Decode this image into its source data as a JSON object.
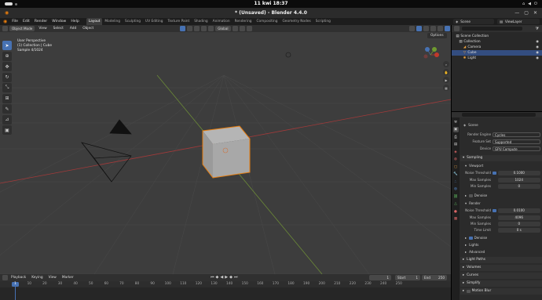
{
  "system": {
    "clock": "11 kwi  18:37"
  },
  "window": {
    "title": "* (Unsaved) - Blender 4.4.0"
  },
  "menu": {
    "items": [
      "File",
      "Edit",
      "Render",
      "Window",
      "Help"
    ]
  },
  "workspaces": [
    "Layout",
    "Modeling",
    "Sculpting",
    "UV Editing",
    "Texture Paint",
    "Shading",
    "Animation",
    "Rendering",
    "Compositing",
    "Geometry Nodes",
    "Scripting"
  ],
  "scene_selector": "Scene",
  "view_layer_selector": "ViewLayer",
  "viewport": {
    "mode": "Object Mode",
    "menus": [
      "View",
      "Select",
      "Add",
      "Object"
    ],
    "transform": "Global",
    "options": "Options",
    "info": [
      "User Perspective",
      "(1) Collection | Cube",
      "Sample 4/1024"
    ]
  },
  "outliner": {
    "rows": [
      {
        "label": "Scene Collection",
        "icon": "collection-icon"
      },
      {
        "label": "Collection",
        "icon": "collection-icon"
      },
      {
        "label": "Camera",
        "icon": "camera-icon"
      },
      {
        "label": "Cube",
        "icon": "mesh-icon"
      },
      {
        "label": "Light",
        "icon": "light-icon"
      }
    ]
  },
  "properties": {
    "scene_label": "Scene",
    "render_engine_label": "Render Engine",
    "render_engine": "Cycles",
    "feature_set_label": "Feature Set",
    "feature_set": "Supported",
    "device_label": "Device",
    "device": "GPU Compute",
    "sampling": "Sampling",
    "viewport": "Viewport",
    "noise_threshold_label": "Noise Threshold",
    "vp_noise": "0.1000",
    "max_samples_label": "Max Samples",
    "vp_max": "1024",
    "min_samples_label": "Min Samples",
    "vp_min": "0",
    "denoise": "Denoise",
    "render": "Render",
    "r_noise": "0.0100",
    "r_max": "4096",
    "r_min": "0",
    "time_limit_label": "Time Limit",
    "r_time": "0 s",
    "lights": "Lights",
    "advanced": "Advanced",
    "sections": [
      "Light Paths",
      "Volumes",
      "Curves",
      "Simplify",
      "Motion Blur"
    ]
  },
  "timeline": {
    "menus": [
      "Playback",
      "Keying",
      "View",
      "Marker"
    ],
    "current_frame": "1",
    "start_label": "Start",
    "start": "1",
    "end_label": "End",
    "end": "250",
    "ticks": [
      "1",
      "10",
      "20",
      "30",
      "40",
      "50",
      "60",
      "70",
      "80",
      "90",
      "100",
      "110",
      "120",
      "130",
      "140",
      "150",
      "160",
      "170",
      "180",
      "190",
      "200",
      "210",
      "220",
      "230",
      "240",
      "250"
    ]
  },
  "colors": {
    "accent": "#4772b3",
    "selection": "#e87d0d",
    "x_axis": "#c0392b",
    "y_axis": "#6f9a2f"
  }
}
